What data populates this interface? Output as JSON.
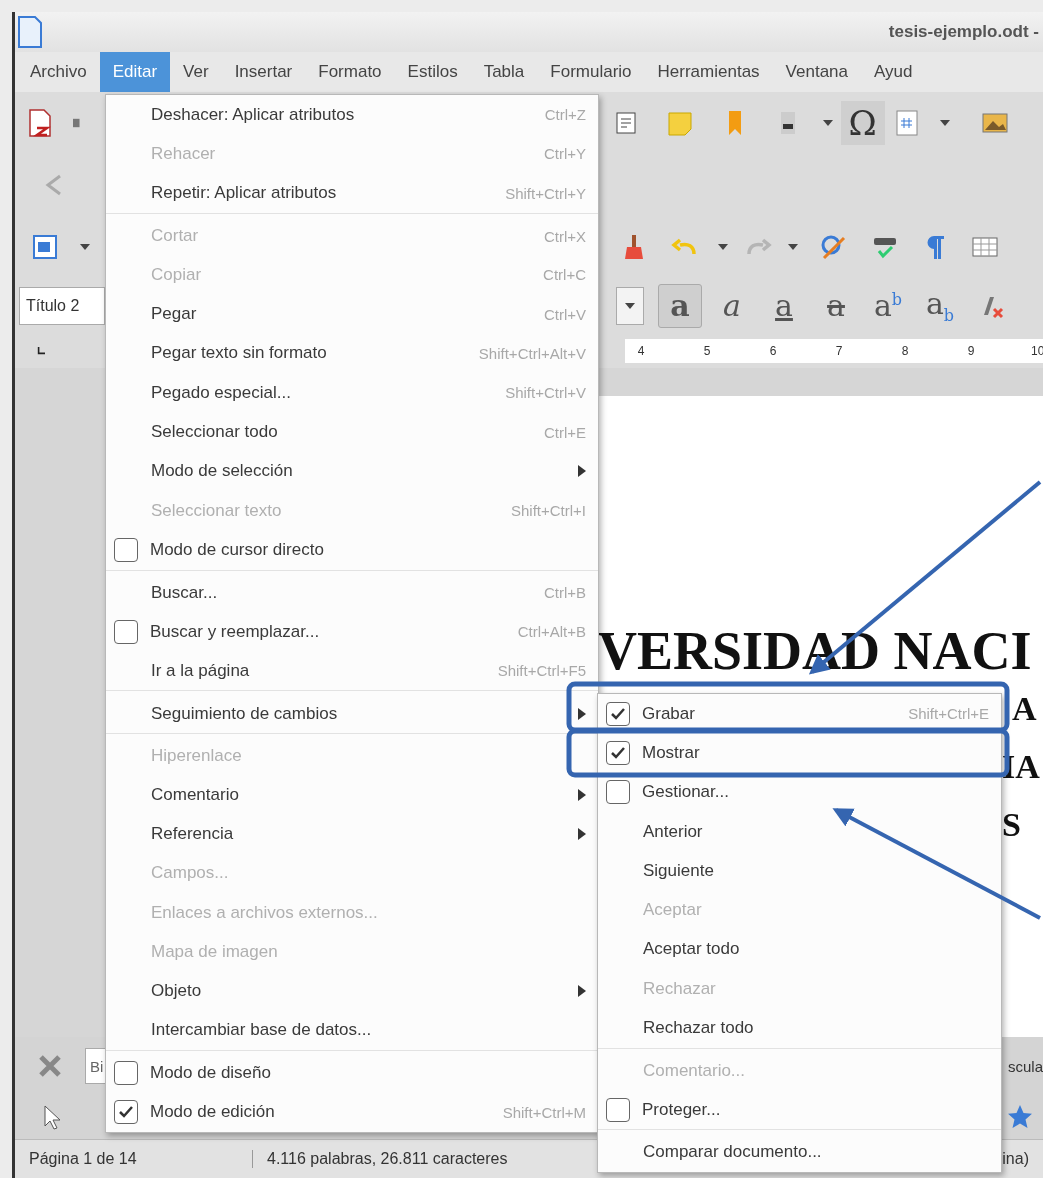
{
  "window": {
    "title": "tesis-ejemplo.odt -"
  },
  "menubar": [
    {
      "label": "Archivo",
      "selected": false
    },
    {
      "label": "Editar",
      "selected": true
    },
    {
      "label": "Ver",
      "selected": false
    },
    {
      "label": "Insertar",
      "selected": false
    },
    {
      "label": "Formato",
      "selected": false
    },
    {
      "label": "Estilos",
      "selected": false
    },
    {
      "label": "Tabla",
      "selected": false
    },
    {
      "label": "Formulario",
      "selected": false
    },
    {
      "label": "Herramientas",
      "selected": false
    },
    {
      "label": "Ventana",
      "selected": false
    },
    {
      "label": "Ayud",
      "selected": false
    }
  ],
  "toolbar": {
    "symbol_button": "Ω",
    "paragraph_style": "Título 2",
    "format_buttons": [
      {
        "glyph": "a",
        "kind": "bold"
      },
      {
        "glyph": "a",
        "kind": "italic"
      },
      {
        "glyph": "a",
        "kind": "underline"
      },
      {
        "glyph": "a",
        "kind": "strikethrough"
      },
      {
        "glyph": "a$^{b}$",
        "kind": "superscript"
      },
      {
        "glyph": "a$_{b}$",
        "kind": "subscript"
      }
    ]
  },
  "ruler": {
    "labels": [
      "4",
      "5",
      "6",
      "7",
      "8",
      "9",
      "10"
    ]
  },
  "document": {
    "lines": [
      "VERSIDAD NACI",
      "A",
      "IA",
      "S"
    ]
  },
  "find_toolbar": {
    "search_value": "Bi",
    "option_label": "scula"
  },
  "status_bar": {
    "page": "Página 1 de 14",
    "word_count": "4.116 palabras, 26.811 caracteres",
    "layout": "ina)"
  },
  "edit_menu": {
    "items": [
      {
        "label": "Deshacer: Aplicar atributos",
        "shortcut": "Ctrl+Z",
        "kind": "command",
        "disabled": false,
        "separator_before": false
      },
      {
        "label": "Rehacer",
        "shortcut": "Ctrl+Y",
        "kind": "command",
        "disabled": true,
        "separator_before": false
      },
      {
        "label": "Repetir: Aplicar atributos",
        "shortcut": "Shift+Ctrl+Y",
        "kind": "command",
        "disabled": false,
        "separator_before": false
      },
      {
        "label": "Cortar",
        "shortcut": "Ctrl+X",
        "kind": "command",
        "disabled": true,
        "separator_before": true
      },
      {
        "label": "Copiar",
        "shortcut": "Ctrl+C",
        "kind": "command",
        "disabled": true,
        "separator_before": false
      },
      {
        "label": "Pegar",
        "shortcut": "Ctrl+V",
        "kind": "command",
        "disabled": false,
        "separator_before": false
      },
      {
        "label": "Pegar texto sin formato",
        "shortcut": "Shift+Ctrl+Alt+V",
        "kind": "command",
        "disabled": false,
        "separator_before": false
      },
      {
        "label": "Pegado especial...",
        "shortcut": "Shift+Ctrl+V",
        "kind": "command",
        "disabled": false,
        "separator_before": false
      },
      {
        "label": "Seleccionar todo",
        "shortcut": "Ctrl+E",
        "kind": "command",
        "disabled": false,
        "separator_before": false
      },
      {
        "label": "Modo de selección",
        "kind": "submenu",
        "disabled": false,
        "separator_before": false
      },
      {
        "label": "Seleccionar texto",
        "shortcut": "Shift+Ctrl+I",
        "kind": "command",
        "disabled": true,
        "separator_before": false
      },
      {
        "label": "Modo de cursor directo",
        "kind": "check",
        "checked": false,
        "disabled": false,
        "separator_before": false
      },
      {
        "label": "Buscar...",
        "shortcut": "Ctrl+B",
        "kind": "command",
        "disabled": false,
        "separator_before": true
      },
      {
        "label": "Buscar y reemplazar...",
        "shortcut": "Ctrl+Alt+B",
        "kind": "check",
        "checked": false,
        "disabled": false,
        "separator_before": false
      },
      {
        "label": "Ir a la página",
        "shortcut": "Shift+Ctrl+F5",
        "kind": "command",
        "disabled": false,
        "separator_before": false
      },
      {
        "label": "Seguimiento de cambios",
        "kind": "submenu",
        "disabled": false,
        "separator_before": true
      },
      {
        "label": "Hiperenlace",
        "kind": "command",
        "disabled": true,
        "separator_before": true
      },
      {
        "label": "Comentario",
        "kind": "submenu",
        "disabled": false,
        "separator_before": false
      },
      {
        "label": "Referencia",
        "kind": "submenu",
        "disabled": false,
        "separator_before": false
      },
      {
        "label": "Campos...",
        "kind": "command",
        "disabled": true,
        "separator_before": false
      },
      {
        "label": "Enlaces a archivos externos...",
        "kind": "command",
        "disabled": true,
        "separator_before": false
      },
      {
        "label": "Mapa de imagen",
        "kind": "command",
        "disabled": true,
        "separator_before": false
      },
      {
        "label": "Objeto",
        "kind": "submenu",
        "disabled": false,
        "separator_before": false
      },
      {
        "label": "Intercambiar base de datos...",
        "kind": "command",
        "disabled": false,
        "separator_before": false
      },
      {
        "label": "Modo de diseño",
        "kind": "check",
        "checked": false,
        "disabled": false,
        "separator_before": true
      },
      {
        "label": "Modo de edición",
        "shortcut": "Shift+Ctrl+M",
        "kind": "check",
        "checked": true,
        "disabled": false,
        "separator_before": false
      }
    ]
  },
  "track_changes_submenu": {
    "items": [
      {
        "label": "Grabar",
        "shortcut": "Shift+Ctrl+E",
        "kind": "check",
        "checked": true,
        "disabled": false,
        "separator_before": false
      },
      {
        "label": "Mostrar",
        "kind": "check",
        "checked": true,
        "disabled": false,
        "separator_before": false
      },
      {
        "label": "Gestionar...",
        "kind": "check",
        "checked": false,
        "disabled": false,
        "separator_before": false
      },
      {
        "label": "Anterior",
        "kind": "command",
        "disabled": false,
        "separator_before": false
      },
      {
        "label": "Siguiente",
        "kind": "command",
        "disabled": false,
        "separator_before": false
      },
      {
        "label": "Aceptar",
        "kind": "command",
        "disabled": true,
        "separator_before": false
      },
      {
        "label": "Aceptar todo",
        "kind": "command",
        "disabled": false,
        "separator_before": false
      },
      {
        "label": "Rechazar",
        "kind": "command",
        "disabled": true,
        "separator_before": false
      },
      {
        "label": "Rechazar todo",
        "kind": "command",
        "disabled": false,
        "separator_before": false
      },
      {
        "label": "Comentario...",
        "kind": "command",
        "disabled": true,
        "separator_before": true
      },
      {
        "label": "Proteger...",
        "kind": "check",
        "checked": false,
        "disabled": false,
        "separator_before": false
      },
      {
        "label": "Comparar documento...",
        "kind": "command",
        "disabled": false,
        "separator_before": true
      }
    ]
  }
}
